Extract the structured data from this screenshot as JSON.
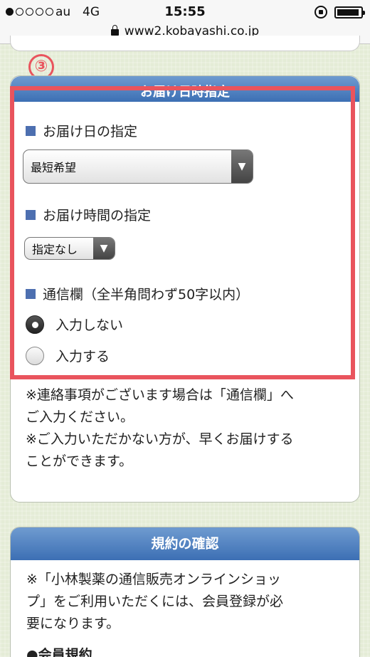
{
  "status_bar": {
    "carrier": "au",
    "network": "4G",
    "time": "15:55"
  },
  "url_bar": {
    "url": "www2.kobayashi.co.jp"
  },
  "annotation": {
    "number": "③",
    "color": "#e9545d"
  },
  "delivery_section": {
    "header": "お届け日時指定",
    "date_label": "お届け日の指定",
    "date_select": {
      "value": "最短希望"
    },
    "time_label": "お届け時間の指定",
    "time_select": {
      "value": "指定なし"
    },
    "message_label": "通信欄（全半角問わず50字以内）",
    "radio_options": [
      {
        "label": "入力しない",
        "checked": true
      },
      {
        "label": "入力する",
        "checked": false
      }
    ],
    "note_lines": [
      "※連絡事項がございます場合は「通信欄」へ",
      "ご入力ください。",
      "※ご入力いただかない方が、早くお届けする",
      "ことができます。"
    ]
  },
  "terms_section": {
    "header": "規約の確認",
    "text_lines": [
      "※「小林製薬の通信販売オンラインショッ",
      "プ」をご利用いただくには、会員登録が必",
      "要になります。"
    ],
    "sub_heading": "●会員規約"
  },
  "colors": {
    "header_blue": "#3c6fb4",
    "highlight_red": "#e9545d",
    "label_square": "#4d6fb0"
  }
}
